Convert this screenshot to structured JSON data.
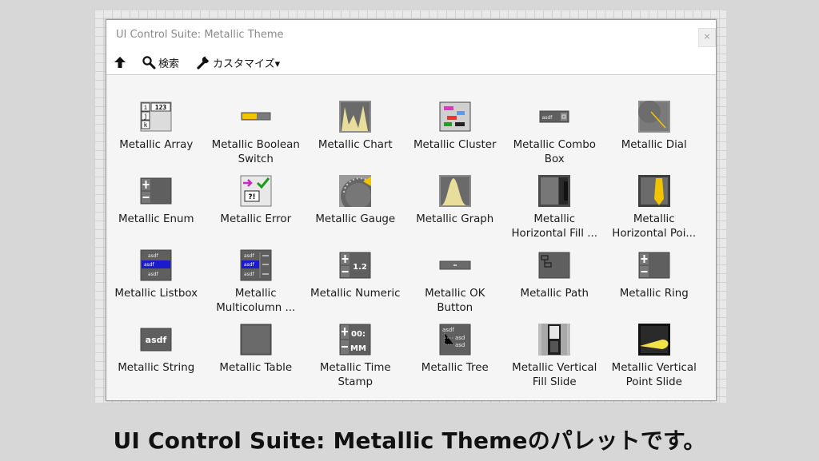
{
  "window": {
    "title": "UI Control Suite: Metallic Theme",
    "close_label": "×"
  },
  "toolbar": {
    "search_label": "検索",
    "customize_label": "カスタマイズ▾"
  },
  "palette_items": [
    {
      "label": "Metallic Array",
      "icon": "array-icon"
    },
    {
      "label": "Metallic Boolean Switch",
      "icon": "boolean-switch-icon"
    },
    {
      "label": "Metallic Chart",
      "icon": "chart-icon"
    },
    {
      "label": "Metallic Cluster",
      "icon": "cluster-icon"
    },
    {
      "label": "Metallic Combo Box",
      "icon": "combo-box-icon"
    },
    {
      "label": "Metallic Dial",
      "icon": "dial-icon"
    },
    {
      "label": "Metallic Enum",
      "icon": "enum-icon"
    },
    {
      "label": "Metallic Error",
      "icon": "error-icon"
    },
    {
      "label": "Metallic Gauge",
      "icon": "gauge-icon"
    },
    {
      "label": "Metallic Graph",
      "icon": "graph-icon"
    },
    {
      "label": "Metallic Horizontal Fill ...",
      "icon": "horizontal-fill-slide-icon"
    },
    {
      "label": "Metallic Horizontal Poi...",
      "icon": "horizontal-pointer-slide-icon"
    },
    {
      "label": "Metallic Listbox",
      "icon": "listbox-icon"
    },
    {
      "label": "Metallic Multicolumn ...",
      "icon": "multicolumn-listbox-icon"
    },
    {
      "label": "Metallic Numeric",
      "icon": "numeric-icon"
    },
    {
      "label": "Metallic OK Button",
      "icon": "ok-button-icon"
    },
    {
      "label": "Metallic Path",
      "icon": "path-icon"
    },
    {
      "label": "Metallic Ring",
      "icon": "ring-icon"
    },
    {
      "label": "Metallic String",
      "icon": "string-icon"
    },
    {
      "label": "Metallic Table",
      "icon": "table-icon"
    },
    {
      "label": "Metallic Time Stamp",
      "icon": "time-stamp-icon"
    },
    {
      "label": "Metallic Tree",
      "icon": "tree-icon"
    },
    {
      "label": "Metallic Vertical Fill Slide",
      "icon": "vertical-fill-slide-icon"
    },
    {
      "label": "Metallic Vertical Point Slide",
      "icon": "vertical-pointer-slide-icon"
    }
  ],
  "icon_text": {
    "array": "123",
    "string": "asdf",
    "numeric": "1.2",
    "time": "00:",
    "time2": "MM",
    "error": "?!"
  },
  "caption": "UI Control Suite: Metallic Themeのパレットです。",
  "colors": {
    "metal_dark": "#5f5f5f",
    "metal_light": "#8c8c8c",
    "accent_yellow": "#f2c400",
    "list_blue": "#1a1acf"
  }
}
